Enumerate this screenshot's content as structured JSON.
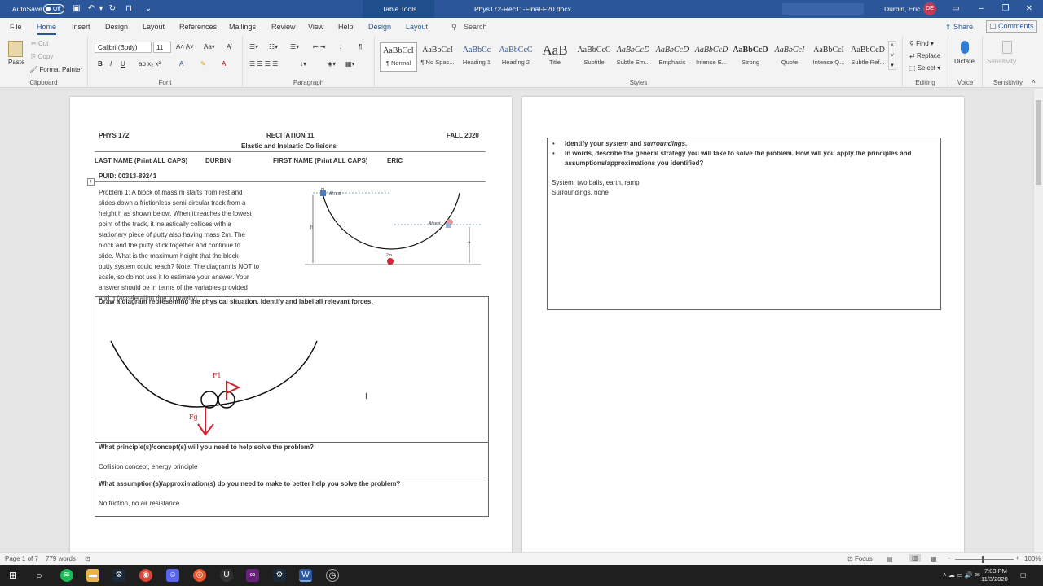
{
  "titlebar": {
    "autosave": "AutoSave",
    "autosave_state": "Off",
    "context": "Table Tools",
    "filename": "Phys172-Rec11-Final-F20.docx",
    "user": "Durbin, Eric",
    "initials": "DE"
  },
  "tabs": {
    "file": "File",
    "home": "Home",
    "insert": "Insert",
    "design": "Design",
    "layout": "Layout",
    "references": "References",
    "mailings": "Mailings",
    "review": "Review",
    "view": "View",
    "help": "Help",
    "design2": "Design",
    "layout2": "Layout",
    "search": "Search",
    "share": "Share",
    "comments": "Comments"
  },
  "ribbon": {
    "clipboard": {
      "paste": "Paste",
      "cut": "Cut",
      "copy": "Copy",
      "painter": "Format Painter",
      "label": "Clipboard"
    },
    "font": {
      "name": "Calibri (Body)",
      "size": "11",
      "label": "Font"
    },
    "paragraph": {
      "label": "Paragraph"
    },
    "styles": {
      "label": "Styles",
      "items": [
        {
          "preview": "AaBbCcI",
          "name": "¶ Normal"
        },
        {
          "preview": "AaBbCcI",
          "name": "¶ No Spac..."
        },
        {
          "preview": "AaBbCc",
          "name": "Heading 1"
        },
        {
          "preview": "AaBbCcC",
          "name": "Heading 2"
        },
        {
          "preview": "AaB",
          "name": "Title"
        },
        {
          "preview": "AaBbCcC",
          "name": "Subtitle"
        },
        {
          "preview": "AaBbCcD",
          "name": "Subtle Em..."
        },
        {
          "preview": "AaBbCcD",
          "name": "Emphasis"
        },
        {
          "preview": "AaBbCcD",
          "name": "Intense E..."
        },
        {
          "preview": "AaBbCcD",
          "name": "Strong"
        },
        {
          "preview": "AaBbCcI",
          "name": "Quote"
        },
        {
          "preview": "AaBbCcI",
          "name": "Intense Q..."
        },
        {
          "preview": "AaBbCcD",
          "name": "Subtle Ref..."
        }
      ]
    },
    "editing": {
      "find": "Find",
      "replace": "Replace",
      "select": "Select",
      "label": "Editing"
    },
    "voice": {
      "dictate": "Dictate",
      "label": "Voice"
    },
    "sensitivity": {
      "btn": "Sensitivity",
      "label": "Sensitivity"
    }
  },
  "doc": {
    "course": "PHYS 172",
    "recitation": "RECITATION 11",
    "term": "FALL 2020",
    "topic": "Elastic and Inelastic Collisions",
    "lastname_label": "LAST NAME (Print ALL CAPS)",
    "lastname": "DURBIN",
    "firstname_label": "FIRST NAME (Print ALL CAPS)",
    "firstname": "ERIC",
    "puid": "PUID: 00313-89241",
    "problem_lines": [
      "Problem 1: A block of mass m starts from rest and",
      "slides down a frictionless semi-circular track from a",
      "height h as shown below. When it reaches the lowest",
      "point of the track, it inelastically collides with a",
      "stationary piece of putty also having mass 2m. The",
      "block and the putty stick together and continue to",
      "slide. What is the maximum height that the block-",
      "putty system could reach? Note: The diagram is NOT to",
      "scale, so do not use it to estimate your answer. Your",
      "answer should be in terms of the variables provided",
      "and g (acceleration due to gravity)."
    ],
    "fig": {
      "m": "m",
      "at_rest1": "At rest",
      "at_rest2": "At rest",
      "h": "h",
      "q": "?",
      "two_m": "2m"
    },
    "draw_prompt": "Draw a diagram representing the physical situation. Identify and label all relevant forces.",
    "sketch": {
      "f1": "F1",
      "fg": "Fg"
    },
    "principle_q": "What principle(s)/concept(s) will you need to help solve the problem?",
    "principle_a": "Collision concept, energy principle",
    "assumption_q": "What assumption(s)/approximation(s) do you need to make to better help you solve the problem?",
    "assumption_a": "No friction, no air resistance",
    "bullet1": "Identify your system and surroundings.",
    "bullet2a": "In words, describe the general strategy you will take to solve the problem. How will you apply the principles and",
    "bullet2b": "assumptions/approximations you identified?",
    "system": "System: two balls, earth, ramp",
    "surroundings": "Surroundings, none"
  },
  "status": {
    "page": "Page 1 of 7",
    "words": "779 words",
    "focus": "Focus",
    "zoom": "100%"
  },
  "taskbar": {
    "time": "7:03 PM",
    "date": "11/3/2020"
  }
}
